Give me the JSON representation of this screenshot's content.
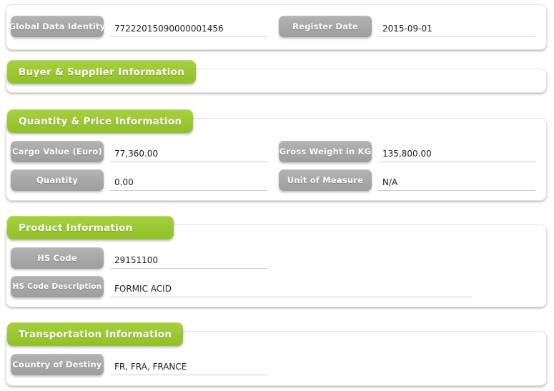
{
  "sections": [
    {
      "id": "identity",
      "title": null,
      "fields": [
        {
          "label": "Global Data Identity",
          "value": "77222015090000001456"
        },
        {
          "label": "Register Date",
          "value": "2015-09-01"
        }
      ]
    },
    {
      "id": "buyer-supplier",
      "title": "Buyer & Supplier Information",
      "fields": []
    },
    {
      "id": "quantity-price",
      "title": "Quantity & Price Information",
      "fields": [
        {
          "label": "Cargo Value (Euro)",
          "value": "77,360.00"
        },
        {
          "label": "Gross Weight in KG",
          "value": "135,800.00"
        },
        {
          "label": "Quantity",
          "value": "0.00"
        },
        {
          "label": "Unit of Measure",
          "value": "N/A"
        }
      ]
    },
    {
      "id": "product",
      "title": "Product Information",
      "fields": [
        {
          "label": "HS Code",
          "value": "29151100"
        },
        {
          "label": "HS Code Description",
          "value": "FORMIC ACID"
        }
      ]
    },
    {
      "id": "transportation",
      "title": "Transportation Information",
      "fields": [
        {
          "label": "Country of Destiny",
          "value": "FR, FRA, FRANCE"
        }
      ]
    }
  ],
  "colors": {
    "accent_green": "#9ac832",
    "label_gray": "#a8a8a8",
    "panel_background": "#ffffff",
    "underline": "#cfcfcf",
    "value_text": "#222222"
  }
}
